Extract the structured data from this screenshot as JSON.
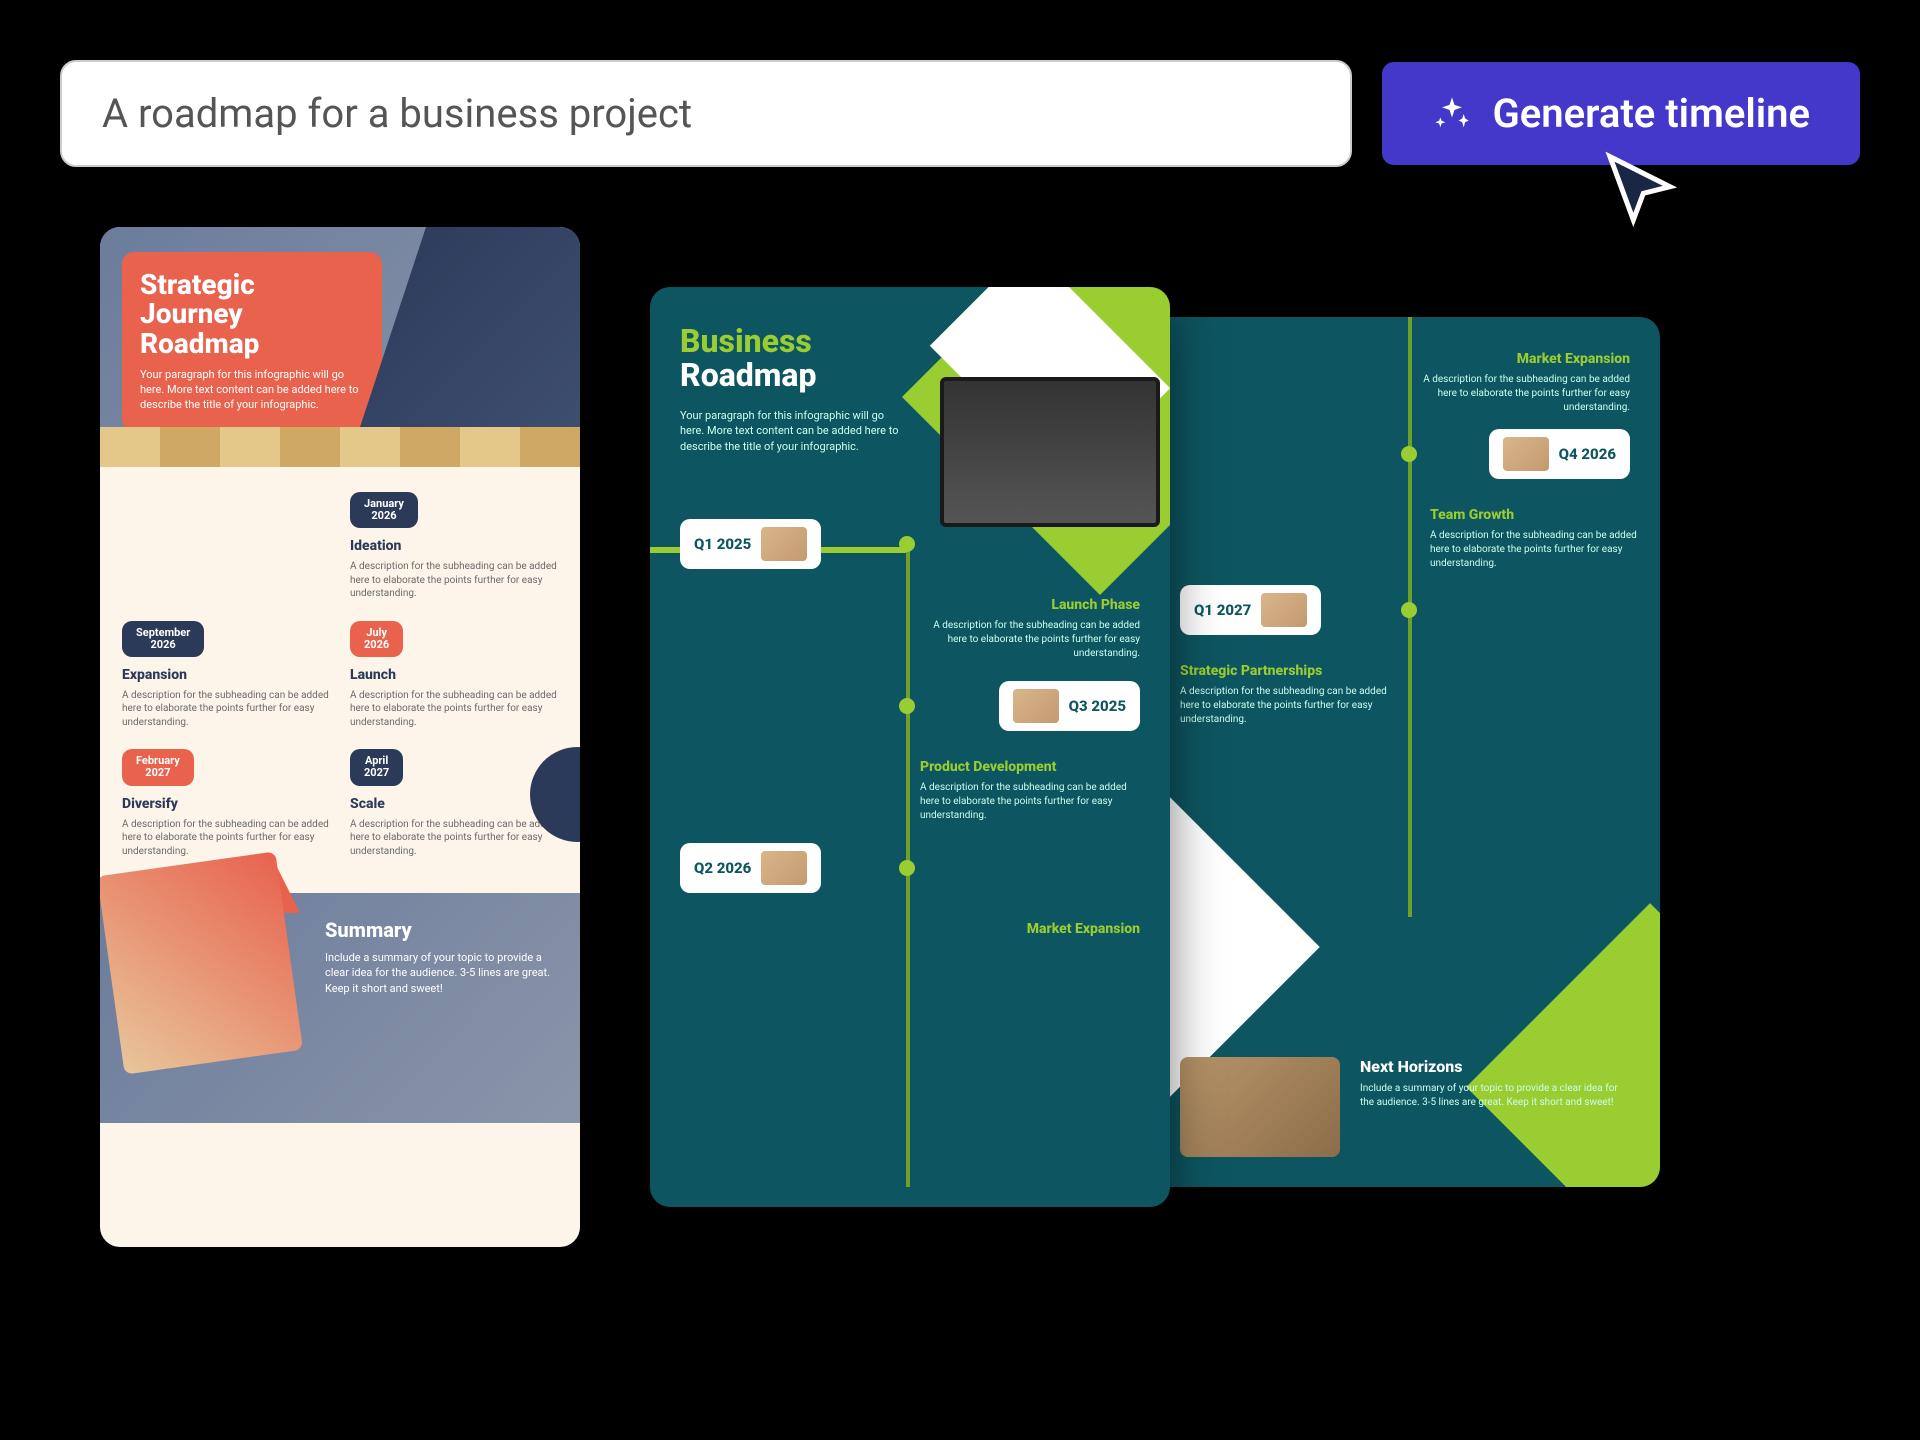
{
  "prompt": "A roadmap for a business project",
  "button": {
    "label": "Generate timeline"
  },
  "template1": {
    "title": "Strategic\nJourney\nRoadmap",
    "desc": "Your paragraph for this infographic will go here. More text content can be added here to describe the title of your infographic.",
    "items": [
      {
        "date": "January\n2026",
        "title": "Ideation",
        "pill": "navy"
      },
      {
        "date": "September\n2026",
        "title": "Expansion",
        "pill": "navy"
      },
      {
        "date": "July\n2026",
        "title": "Launch",
        "pill": "coral"
      },
      {
        "date": "February\n2027",
        "title": "Diversify",
        "pill": "coral"
      },
      {
        "date": "April\n2027",
        "title": "Scale",
        "pill": "navy"
      }
    ],
    "item_desc": "A description for the subheading can be added here to elaborate the points further for easy understanding.",
    "summary": {
      "title": "Summary",
      "desc": "Include a summary of your topic to provide a clear idea for the audience. 3-5 lines are great. Keep it short and sweet!"
    }
  },
  "template2": {
    "title1": "Business",
    "title2": "Roadmap",
    "desc": "Your paragraph for this infographic will go here. More text content can be added here to describe the title of your infographic.",
    "sections": [
      {
        "q": "Q1 2025",
        "label": "Launch Phase",
        "side": "left"
      },
      {
        "q": "Q3 2025",
        "label": "Product Development",
        "side": "right"
      },
      {
        "q": "Q2 2026",
        "label": "Market Expansion",
        "side": "left"
      }
    ],
    "item_desc": "A description for the subheading can be added here to elaborate the points further for easy understanding."
  },
  "template3": {
    "sections": [
      {
        "q": "Q4 2026",
        "label": "Market Expansion",
        "side": "right"
      },
      {
        "q": "Q1 2027",
        "label": "Team Growth",
        "side": "left",
        "label2": "Strategic Partnerships"
      }
    ],
    "item_desc": "A description for the subheading can be added here to elaborate the points further for easy understanding.",
    "summary": {
      "title": "Next Horizons",
      "desc": "Include a summary of your topic to provide a clear idea for the audience. 3-5 lines are great. Keep it short and sweet!"
    }
  }
}
